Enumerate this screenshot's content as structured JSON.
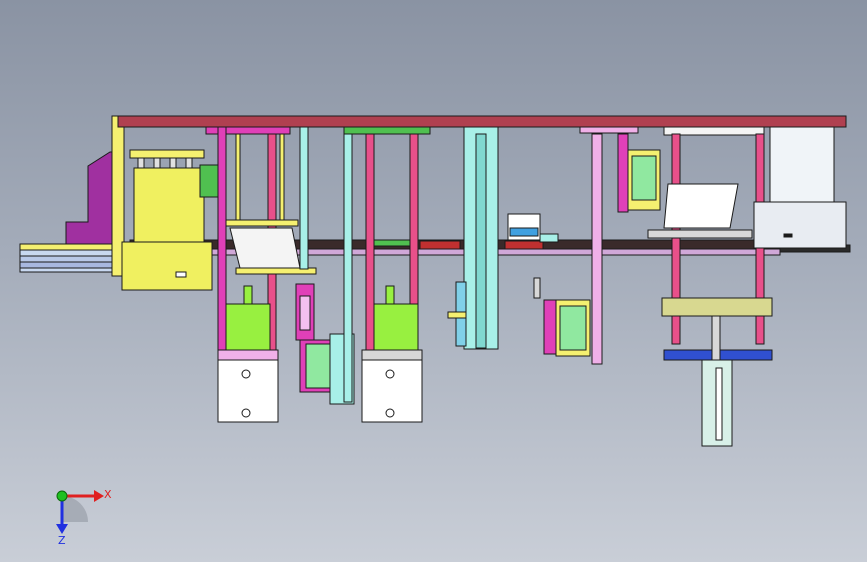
{
  "colors": {
    "background_top": "#8a93a3",
    "background_bottom": "#c9ced7",
    "top_plate": "#b04050",
    "frame_yellow": "#f5f070",
    "frame_magenta": "#e040b8",
    "pink_rod": "#e8508a",
    "lime_block": "#98f040",
    "cyan_rail": "#a8f0e8",
    "module_green": "#90e8a0",
    "purple_housing": "#a030a0",
    "blue_plate": "#3050d0",
    "dark_rail": "#3a2a2a",
    "axis_x": "#e02020",
    "axis_y": "#20c020",
    "axis_z": "#2030e0"
  },
  "triad": {
    "x_label": "X",
    "z_label": "Z",
    "x_icon": "arrow-right-icon",
    "z_icon": "arrow-down-icon",
    "origin_icon": "sphere-icon"
  }
}
